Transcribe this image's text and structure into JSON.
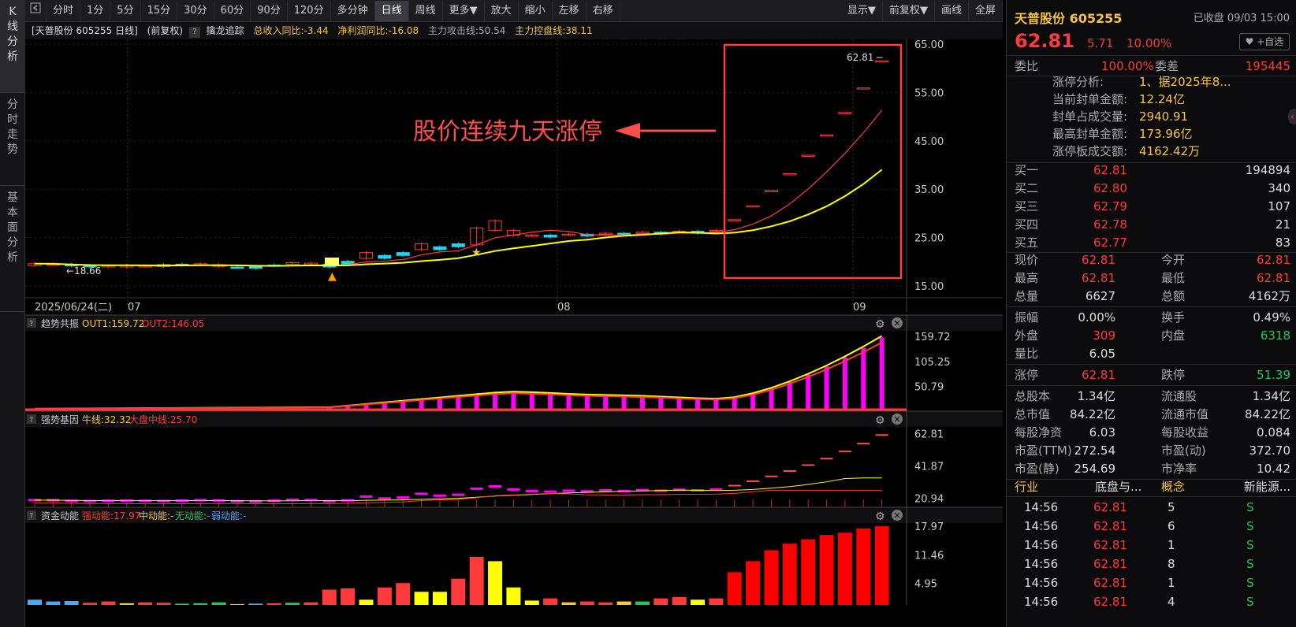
{
  "vtabs": [
    "K线分析",
    "分时走势",
    "基本面分析"
  ],
  "toolbar": {
    "items": [
      "分时",
      "1分",
      "5分",
      "15分",
      "30分",
      "60分",
      "90分",
      "120分",
      "多分钟",
      "日线",
      "周线",
      "更多▼",
      "放大",
      "缩小",
      "左移",
      "右移"
    ],
    "active": "日线",
    "right_items": [
      "显示▼",
      "前复权▼",
      "画线",
      "全屏"
    ]
  },
  "infobar": {
    "stock": "[天普股份 605255 日线]",
    "adj": "(前复权)",
    "indicator": "擒龙追踪",
    "rev": "总收入同比:-3.44",
    "profit": "净利润同比:-16.08",
    "attack": "主力攻击线:50.54",
    "control": "主力控盘线:38.11"
  },
  "chart": {
    "annotation": "股价连续九天涨停",
    "date_label": "2025/06/24(二)",
    "month_labels": [
      "07",
      "08",
      "09"
    ],
    "main_axis": [
      "65.00",
      "55.00",
      "45.00",
      "35.00",
      "25.00",
      "15.00"
    ],
    "low_label": "18.66",
    "high_label": "62.81",
    "colors": {
      "up": "#ff3a3a",
      "down": "#22d3ee",
      "ma1": "#ff3a3a",
      "ma2": "#ffff00",
      "box": "#ff4040",
      "macd": "#ff00ff"
    }
  },
  "panels": {
    "p1": {
      "name": "趋势共振",
      "v1": "OUT1:159.72",
      "v2": "OUT2:146.05",
      "axis": [
        "159.72",
        "105.25",
        "50.79"
      ]
    },
    "p2": {
      "name": "强势基因",
      "v1": "牛线:32.32",
      "v2": "大盘中线:25.70",
      "axis": [
        "62.81",
        "41.87",
        "20.94"
      ]
    },
    "p3": {
      "name": "资金动能",
      "v1": "强动能:17.97",
      "v2": "中动能:-",
      "v3": "无动能:-",
      "v4": "弱动能:-",
      "axis": [
        "17.97",
        "11.46",
        "4.95"
      ]
    }
  },
  "quote": {
    "name": "天普股份",
    "code": "605255",
    "status": "已收盘 09/03 15:00",
    "price": "62.81",
    "change": "5.71",
    "pct": "10.00%",
    "fav": "♥ +自选",
    "weibi_label": "委比",
    "weibi": "100.00%",
    "weicha_label": "委差",
    "weicha": "195445",
    "limit_info": [
      {
        "k": "涨停分析:",
        "v": "1、据2025年8..."
      },
      {
        "k": "当前封单金额:",
        "v": "12.24亿"
      },
      {
        "k": "封单占成交量:",
        "v": "2940.91"
      },
      {
        "k": "最高封单金额:",
        "v": "173.96亿"
      },
      {
        "k": "涨停板成交额:",
        "v": "4162.42万"
      }
    ],
    "bids": [
      {
        "l": "买一",
        "p": "62.81",
        "v": "194894"
      },
      {
        "l": "买二",
        "p": "62.80",
        "v": "340"
      },
      {
        "l": "买三",
        "p": "62.79",
        "v": "107"
      },
      {
        "l": "买四",
        "p": "62.78",
        "v": "21"
      },
      {
        "l": "买五",
        "p": "62.77",
        "v": "83"
      }
    ],
    "stats": [
      {
        "k1": "现价",
        "v1": "62.81",
        "c1": "red",
        "k2": "今开",
        "v2": "62.81",
        "c2": "red"
      },
      {
        "k1": "最高",
        "v1": "62.81",
        "c1": "red",
        "k2": "最低",
        "v2": "62.81",
        "c2": "red"
      },
      {
        "k1": "总量",
        "v1": "6627",
        "c1": "white",
        "k2": "总额",
        "v2": "4162万",
        "c2": "white"
      }
    ],
    "stats2": [
      {
        "k1": "振幅",
        "v1": "0.00%",
        "c1": "white",
        "k2": "换手",
        "v2": "0.49%",
        "c2": "white"
      },
      {
        "k1": "外盘",
        "v1": "309",
        "c1": "red",
        "k2": "内盘",
        "v2": "6318",
        "c2": "green"
      },
      {
        "k1": "量比",
        "v1": "6.05",
        "c1": "white",
        "k2": "",
        "v2": "",
        "c2": "white"
      }
    ],
    "stats3": [
      {
        "k1": "涨停",
        "v1": "62.81",
        "c1": "red",
        "k2": "跌停",
        "v2": "51.39",
        "c2": "green"
      }
    ],
    "stats4": [
      {
        "k1": "总股本",
        "v1": "1.34亿",
        "c1": "white",
        "k2": "流通股",
        "v2": "1.34亿",
        "c2": "white"
      },
      {
        "k1": "总市值",
        "v1": "84.22亿",
        "c1": "white",
        "k2": "流通市值",
        "v2": "84.22亿",
        "c2": "white"
      },
      {
        "k1": "每股净资",
        "v1": "6.03",
        "c1": "white",
        "k2": "每股收益",
        "v2": "0.084",
        "c2": "white"
      },
      {
        "k1": "市盈(TTM)",
        "v1": "272.54",
        "c1": "white",
        "k2": "市盈(动)",
        "v2": "372.70",
        "c2": "white"
      },
      {
        "k1": "市盈(静)",
        "v1": "254.69",
        "c1": "white",
        "k2": "市净率",
        "v2": "10.42",
        "c2": "white"
      }
    ],
    "industry": {
      "k1": "行业",
      "v1": "底盘与...",
      "k2": "概念",
      "v2": "新能源..."
    },
    "ticks": [
      {
        "t": "14:56",
        "p": "62.81",
        "v": "5",
        "s": "S"
      },
      {
        "t": "14:56",
        "p": "62.81",
        "v": "6",
        "s": "S"
      },
      {
        "t": "14:56",
        "p": "62.81",
        "v": "1",
        "s": "S"
      },
      {
        "t": "14:56",
        "p": "62.81",
        "v": "8",
        "s": "S"
      },
      {
        "t": "14:56",
        "p": "62.81",
        "v": "1",
        "s": "S"
      },
      {
        "t": "14:56",
        "p": "62.81",
        "v": "4",
        "s": "S"
      }
    ]
  }
}
